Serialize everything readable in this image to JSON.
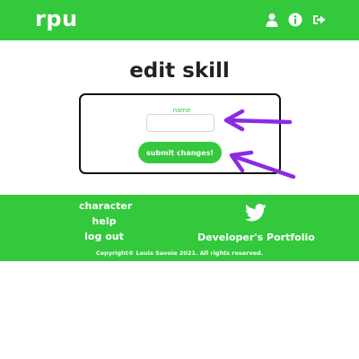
{
  "header": {
    "brand": "rpu",
    "icons": [
      "user-icon",
      "info-icon",
      "sign-out-icon"
    ],
    "color": "#34c93d"
  },
  "main": {
    "title": "edit skill",
    "form": {
      "field_label": "name",
      "field_value": "",
      "submit_label": "submit changes!"
    },
    "annotation_arrow_color": "#8a2be2"
  },
  "footer": {
    "links": [
      "character",
      "help",
      "log out"
    ],
    "portfolio_label": "Developer's Portfolio",
    "social_icon": "twitter-icon",
    "copyright": "Copyright© Louis Savoie 2021. All rights reserved."
  }
}
